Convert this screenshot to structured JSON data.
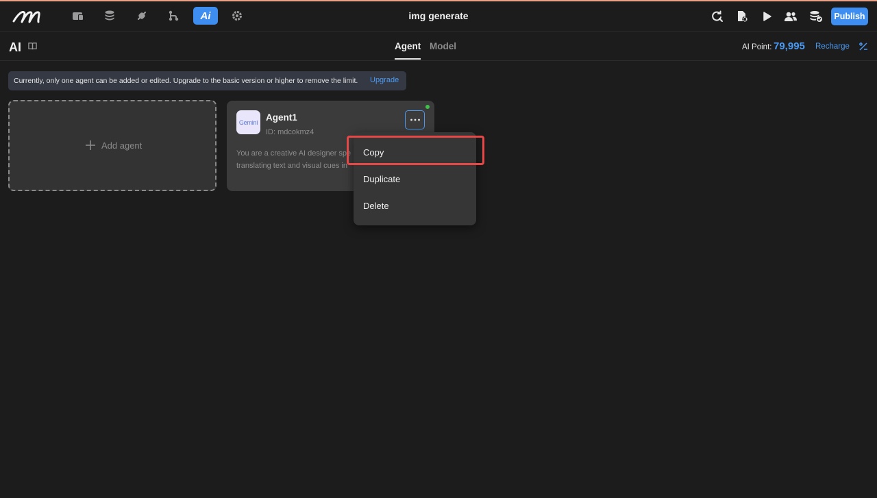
{
  "header": {
    "app_title": "img generate",
    "publish_label": "Publish",
    "nav_icons": [
      "dashboard-icon",
      "database-icon",
      "plugin-icon",
      "workflow-icon",
      "ai-icon",
      "settings-icon"
    ],
    "active_nav": "ai-icon",
    "ai_nav_label": "Ai",
    "right_icons": [
      "search-refresh-icon",
      "file-settings-icon",
      "play-icon",
      "users-icon",
      "database-check-icon"
    ]
  },
  "subheader": {
    "page_title": "AI",
    "tabs": [
      {
        "label": "Agent",
        "active": true
      },
      {
        "label": "Model",
        "active": false
      }
    ],
    "ai_point_label": "AI Point:",
    "ai_point_value": "79,995",
    "recharge_label": "Recharge"
  },
  "notice": {
    "text": "Currently, only one agent can be added or edited. Upgrade to the basic version or higher to remove the limit.",
    "link_label": "Upgrade"
  },
  "add_agent": {
    "label": "Add agent"
  },
  "agent_card": {
    "avatar_text": "Gemini",
    "name": "Agent1",
    "id_text": "ID: mdcokmz4",
    "description_line1": "You are a creative AI designer spe",
    "description_line2": "translating text and visual cues in",
    "status": "online"
  },
  "context_menu": {
    "items": [
      "Copy",
      "Duplicate",
      "Delete"
    ],
    "highlighted": "Copy"
  },
  "colors": {
    "accent": "#3d8ef0",
    "link": "#4a9af3",
    "background": "#1c1c1c",
    "highlight_box": "#e64747",
    "status_online": "#3fc24a"
  }
}
